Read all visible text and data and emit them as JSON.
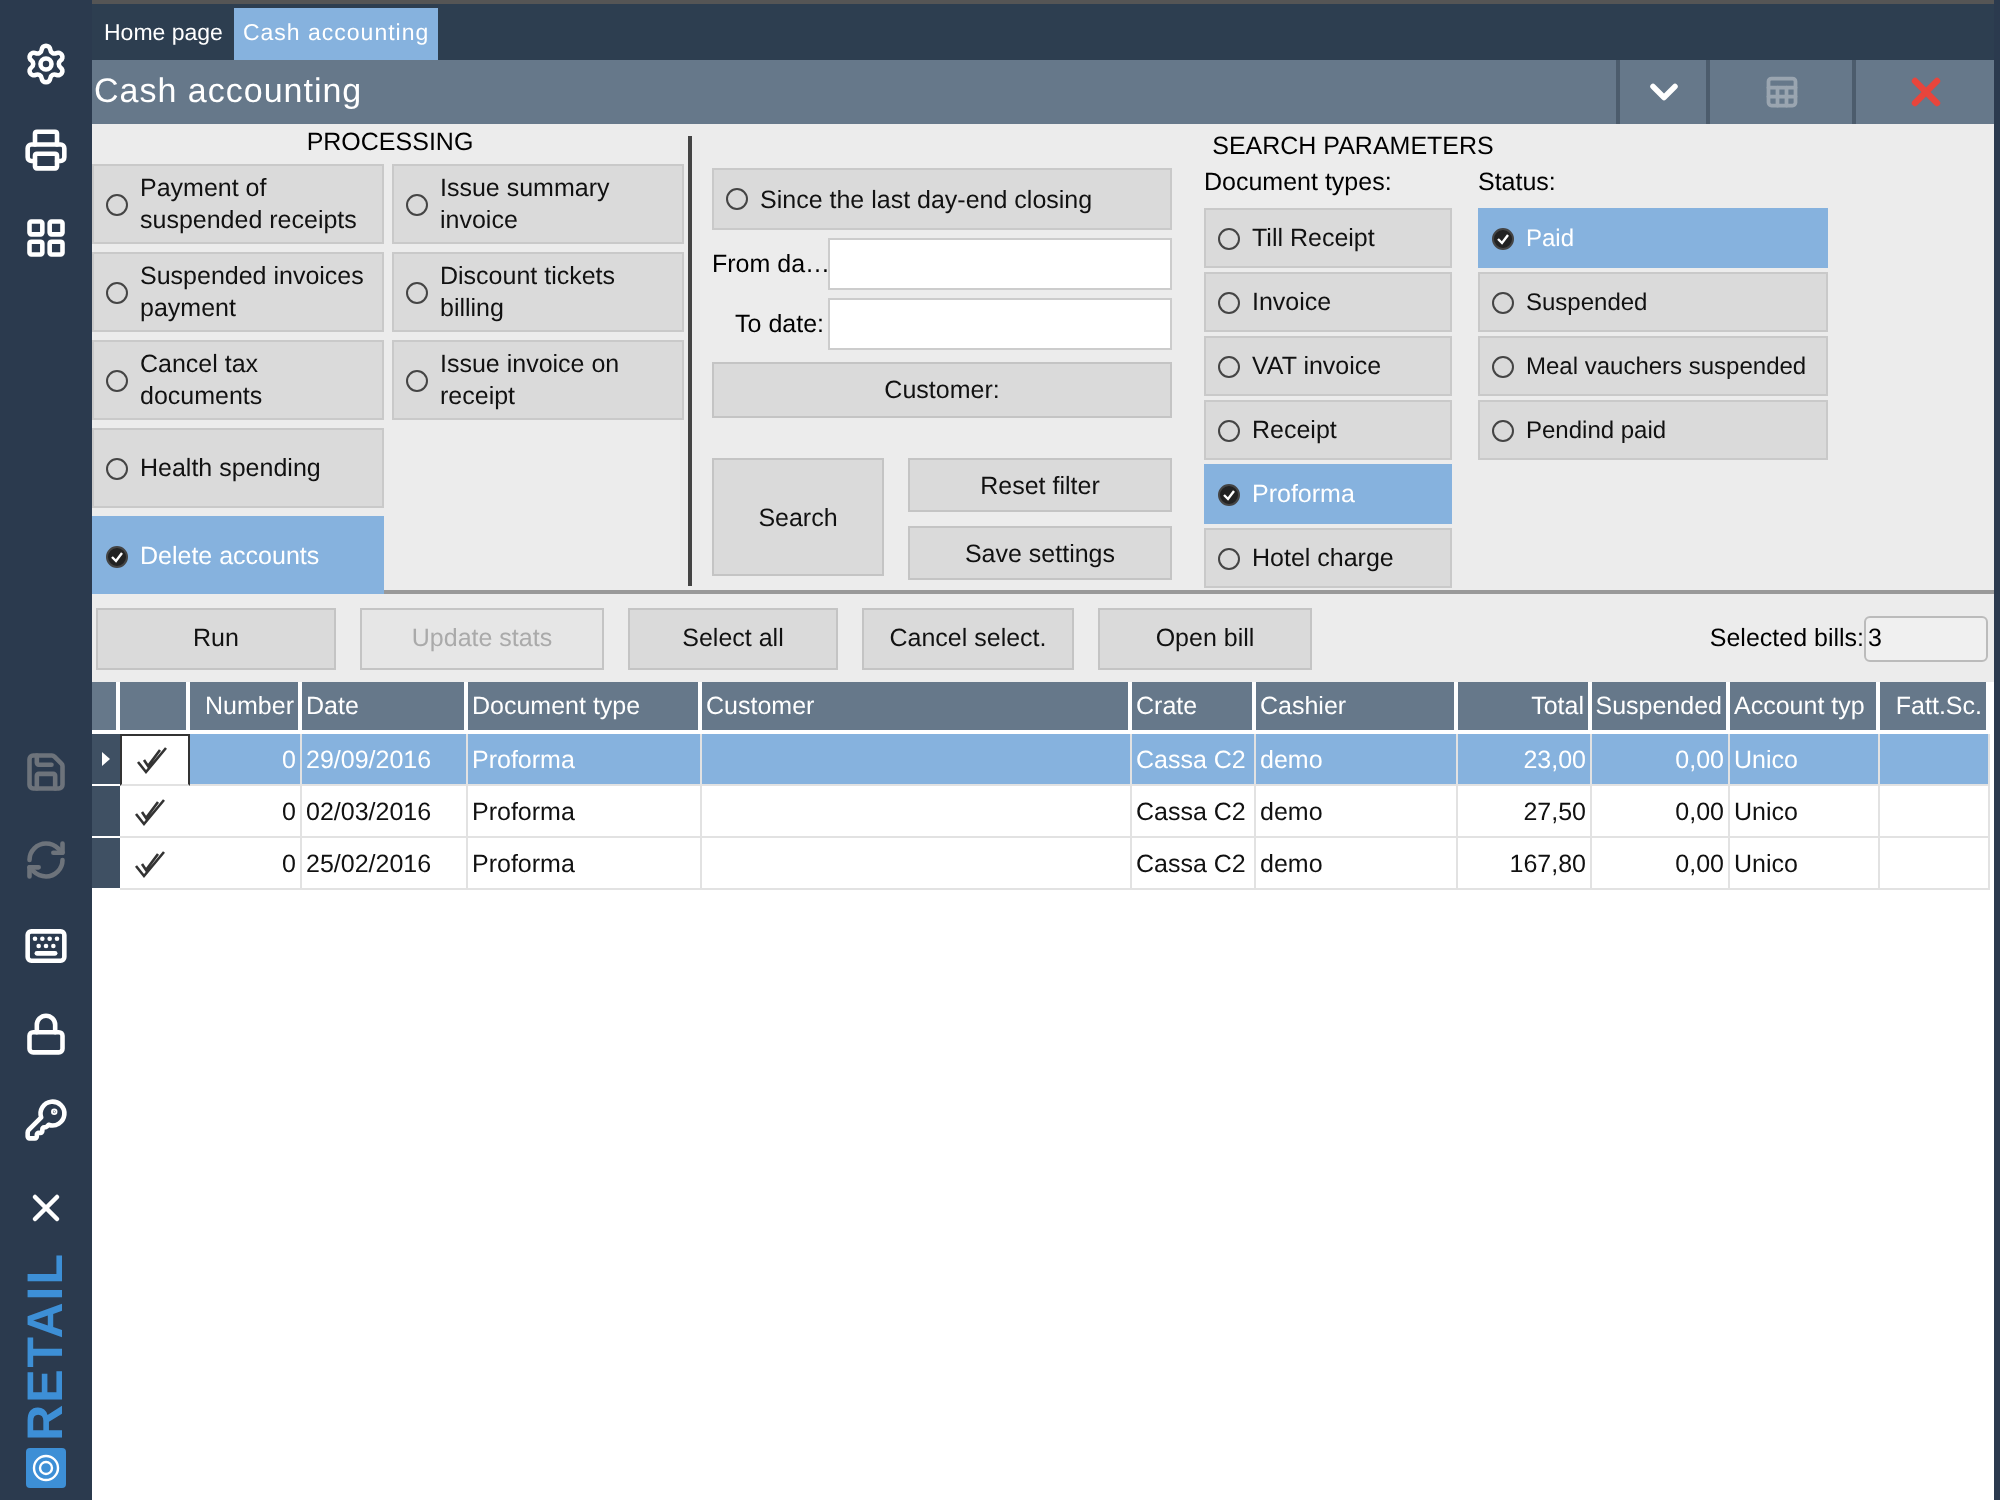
{
  "sidebar": {
    "items": [
      {
        "kind": "settings",
        "disabled": false
      },
      {
        "kind": "register",
        "disabled": false
      },
      {
        "kind": "apps",
        "disabled": false
      },
      {
        "kind": "save",
        "disabled": true
      },
      {
        "kind": "sync",
        "disabled": true
      },
      {
        "kind": "keyboard",
        "disabled": false
      },
      {
        "kind": "lock",
        "disabled": false
      },
      {
        "kind": "key",
        "disabled": false
      },
      {
        "kind": "exit",
        "disabled": false
      }
    ],
    "logo": "RETAIL"
  },
  "tabs": [
    {
      "label": "Home page",
      "selected": false
    },
    {
      "label": "Cash accounting",
      "selected": true
    }
  ],
  "window": {
    "title": "Cash accounting",
    "actions": [
      {
        "kind": "expand",
        "disabled": false
      },
      {
        "kind": "export",
        "disabled": true
      },
      {
        "kind": "close",
        "disabled": false
      }
    ]
  },
  "processing": {
    "title": "PROCESSING",
    "columns": [
      [
        {
          "label": "Payment of suspended receipts",
          "selected": false
        },
        {
          "label": "Suspended invoices payment",
          "selected": false
        },
        {
          "label": "Cancel tax documents",
          "selected": false
        },
        {
          "label": "Health spending",
          "selected": false
        },
        {
          "label": "Delete accounts",
          "selected": true
        }
      ],
      [
        {
          "label": "Issue summary invoice",
          "selected": false
        },
        {
          "label": "Discount tickets billing",
          "selected": false
        },
        {
          "label": "Issue invoice on receipt",
          "selected": false
        }
      ]
    ]
  },
  "search": {
    "title": "SEARCH PARAMETERS",
    "since": {
      "label": "Since the last day-end closing",
      "selected": false
    },
    "from_label": "From da…",
    "to_label": "To date:",
    "customer": "Customer:",
    "search": "Search",
    "reset": "Reset filter",
    "save": "Save settings"
  },
  "document_types": {
    "label": "Document types:",
    "options": [
      {
        "label": "Till Receipt",
        "selected": false
      },
      {
        "label": "Invoice",
        "selected": false
      },
      {
        "label": "VAT invoice",
        "selected": false
      },
      {
        "label": "Receipt",
        "selected": false
      },
      {
        "label": "Proforma",
        "selected": true
      },
      {
        "label": "Hotel charge",
        "selected": false
      }
    ]
  },
  "status": {
    "label": "Status:",
    "options": [
      {
        "label": "Paid",
        "selected": true
      },
      {
        "label": "Suspended",
        "selected": false
      },
      {
        "label": "Meal vauchers suspended",
        "selected": false
      },
      {
        "label": "Pendind paid",
        "selected": false
      }
    ]
  },
  "toolbar": {
    "buttons": [
      {
        "label": "Run",
        "disabled": false
      },
      {
        "label": "Update stats",
        "disabled": true
      },
      {
        "label": "Select all",
        "disabled": false
      },
      {
        "label": "Cancel select.",
        "disabled": false
      },
      {
        "label": "Open bill",
        "disabled": false
      }
    ],
    "selected_bills": {
      "label": "Selected bills:",
      "value": "3"
    }
  },
  "table": {
    "columns": [
      "Number",
      "Date",
      "Document type",
      "Customer",
      "Crate",
      "Cashier",
      "Total",
      "Suspended",
      "Account typ",
      "Fatt.Sc."
    ],
    "rows": [
      {
        "selected": true,
        "checked": true,
        "number": "0",
        "date": "29/09/2016",
        "document_type": "Proforma",
        "crate": "Cassa C2",
        "cashier": "demo",
        "total": "23,00",
        "suspended": "0,00",
        "account_type": "Unico"
      },
      {
        "selected": false,
        "checked": true,
        "number": "0",
        "date": "02/03/2016",
        "document_type": "Proforma",
        "crate": "Cassa C2",
        "cashier": "demo",
        "total": "27,50",
        "suspended": "0,00",
        "account_type": "Unico"
      },
      {
        "selected": false,
        "checked": true,
        "number": "0",
        "date": "25/02/2016",
        "document_type": "Proforma",
        "crate": "Cassa C2",
        "cashier": "demo",
        "total": "167,80",
        "suspended": "0,00",
        "account_type": "Unico"
      }
    ]
  }
}
